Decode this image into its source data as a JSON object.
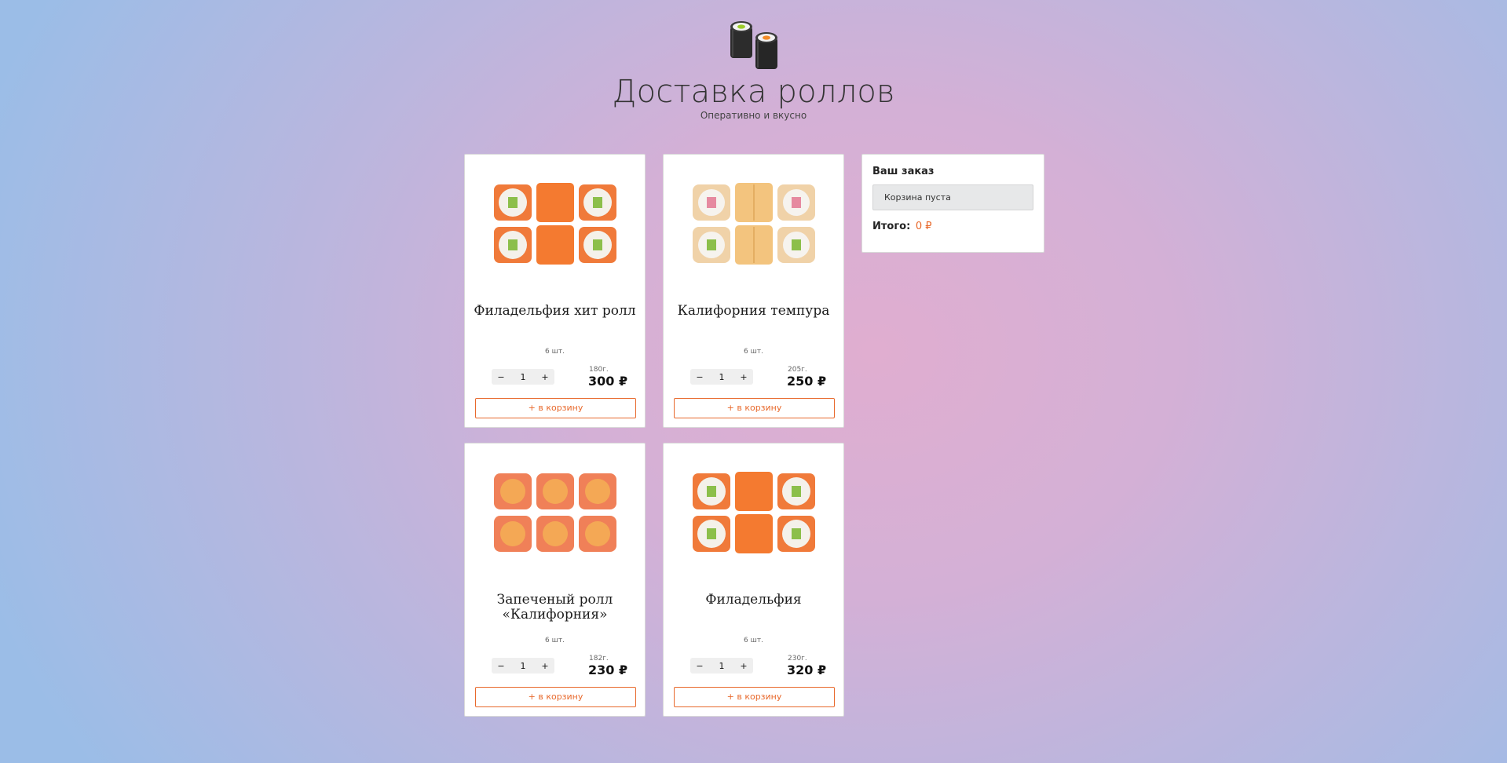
{
  "brand": {
    "title": "Доставка роллов",
    "subtitle": "Оперативно и вкусно"
  },
  "products": [
    {
      "title": "Филадельфия хит ролл",
      "count": "6 шт.",
      "quantity": "1",
      "weight": "180г.",
      "price": "300 ₽",
      "button": "+ в корзину",
      "minus": "−",
      "plus": "+"
    },
    {
      "title": "Калифорния темпура",
      "count": "6 шт.",
      "quantity": "1",
      "weight": "205г.",
      "price": "250 ₽",
      "button": "+ в корзину",
      "minus": "−",
      "plus": "+"
    },
    {
      "title": "Запеченый ролл «Калифорния»",
      "count": "6 шт.",
      "quantity": "1",
      "weight": "182г.",
      "price": "230 ₽",
      "button": "+ в корзину",
      "minus": "−",
      "plus": "+"
    },
    {
      "title": "Филадельфия",
      "count": "6 шт.",
      "quantity": "1",
      "weight": "230г.",
      "price": "320 ₽",
      "button": "+ в корзину",
      "minus": "−",
      "plus": "+"
    }
  ],
  "cart": {
    "title": "Ваш заказ",
    "empty_text": "Корзина пуста",
    "total_label": "Итого:",
    "total_value": "0 ₽"
  },
  "colors": {
    "accent": "#e8692c",
    "background_center": "#e0aed0",
    "background_edge": "#9bbde7"
  }
}
